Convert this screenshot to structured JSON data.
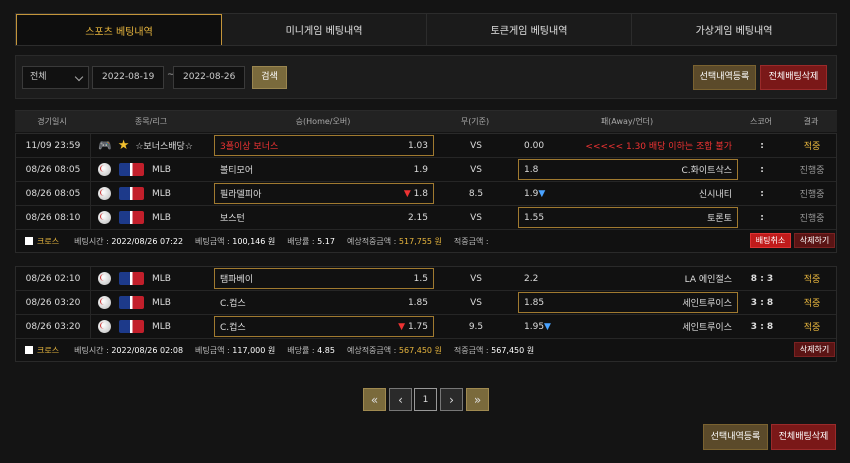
{
  "tabs": [
    {
      "label": "스포츠 베팅내역",
      "active": true
    },
    {
      "label": "미니게임 베팅내역",
      "active": false
    },
    {
      "label": "토큰게임 베팅내역",
      "active": false
    },
    {
      "label": "가상게임 베팅내역",
      "active": false
    }
  ],
  "filter": {
    "select_value": "전체",
    "date_from": "2022-08-19",
    "date_sep": "~",
    "date_to": "2022-08-26",
    "search_label": "검색",
    "register_label": "선택내역등록",
    "delete_all_label": "전체배팅삭제"
  },
  "headers": {
    "date": "경기일시",
    "league": "종목/리그",
    "home": "승(Home/오버)",
    "draw": "무(기준)",
    "away": "패(Away/언더)",
    "score": "스코어",
    "result": "결과"
  },
  "groups": [
    {
      "rows": [
        {
          "date": "11/09 23:59",
          "league": "☆보너스배당☆",
          "home": "3폴이상 보너스",
          "home_odds": "1.03",
          "mid": "VS",
          "away": "<<<<< 1.30 배당 이하는 조합 불가",
          "away_odds": "0.00",
          "score": ":",
          "result": "적중"
        },
        {
          "date": "08/26 08:05",
          "league": "MLB",
          "home": "볼티모어",
          "home_odds": "1.9",
          "mid": "VS",
          "away": "C.화이트삭스",
          "away_odds": "1.8",
          "score": ":",
          "result": "진행중"
        },
        {
          "date": "08/26 08:05",
          "league": "MLB",
          "home": "필라델피아",
          "home_odds": "1.8",
          "home_arrow": "▼",
          "mid": "8.5",
          "away": "신시내티",
          "away_odds": "1.9",
          "away_arrow": "▼",
          "score": ":",
          "result": "진행중"
        },
        {
          "date": "08/26 08:10",
          "league": "MLB",
          "home": "보스턴",
          "home_odds": "2.15",
          "mid": "VS",
          "away": "토론토",
          "away_odds": "1.55",
          "score": ":",
          "result": "진행중"
        }
      ],
      "summary": {
        "type": "크로스",
        "bet_time_label": "베팅시간 :",
        "bet_time": "2022/08/26 07:22",
        "bet_amount_label": "베팅금액 :",
        "bet_amount": "100,146 원",
        "odds_label": "배당률 :",
        "odds": "5.17",
        "expected_label": "예상적중금액 :",
        "expected": "517,755 원",
        "win_label": "적중금액 :",
        "win": "",
        "cancel_label": "배팅취소",
        "delete_label": "삭제하기"
      }
    },
    {
      "rows": [
        {
          "date": "08/26 02:10",
          "league": "MLB",
          "home": "탬파베이",
          "home_odds": "1.5",
          "mid": "VS",
          "away": "LA 에인절스",
          "away_odds": "2.2",
          "score": "8 : 3",
          "result": "적중"
        },
        {
          "date": "08/26 03:20",
          "league": "MLB",
          "home": "C.컵스",
          "home_odds": "1.85",
          "mid": "VS",
          "away": "세인트루이스",
          "away_odds": "1.85",
          "score": "3 : 8",
          "result": "적중"
        },
        {
          "date": "08/26 03:20",
          "league": "MLB",
          "home": "C.컵스",
          "home_odds": "1.75",
          "home_arrow": "▼",
          "mid": "9.5",
          "away": "세인트루이스",
          "away_odds": "1.95",
          "away_arrow": "▼",
          "score": "3 : 8",
          "result": "적중"
        }
      ],
      "summary": {
        "type": "크로스",
        "bet_time_label": "베팅시간 :",
        "bet_time": "2022/08/26 02:08",
        "bet_amount_label": "베팅금액 :",
        "bet_amount": "117,000 원",
        "odds_label": "배당률 :",
        "odds": "4.85",
        "expected_label": "예상적중금액 :",
        "expected": "567,450 원",
        "win_label": "적중금액 :",
        "win": "567,450 원",
        "delete_label": "삭제하기"
      }
    }
  ],
  "pagination": {
    "first": "«",
    "prev": "‹",
    "current": "1",
    "next": "›",
    "last": "»"
  },
  "bottom": {
    "register_label": "선택내역등록",
    "delete_all_label": "전체배팅삭제"
  }
}
